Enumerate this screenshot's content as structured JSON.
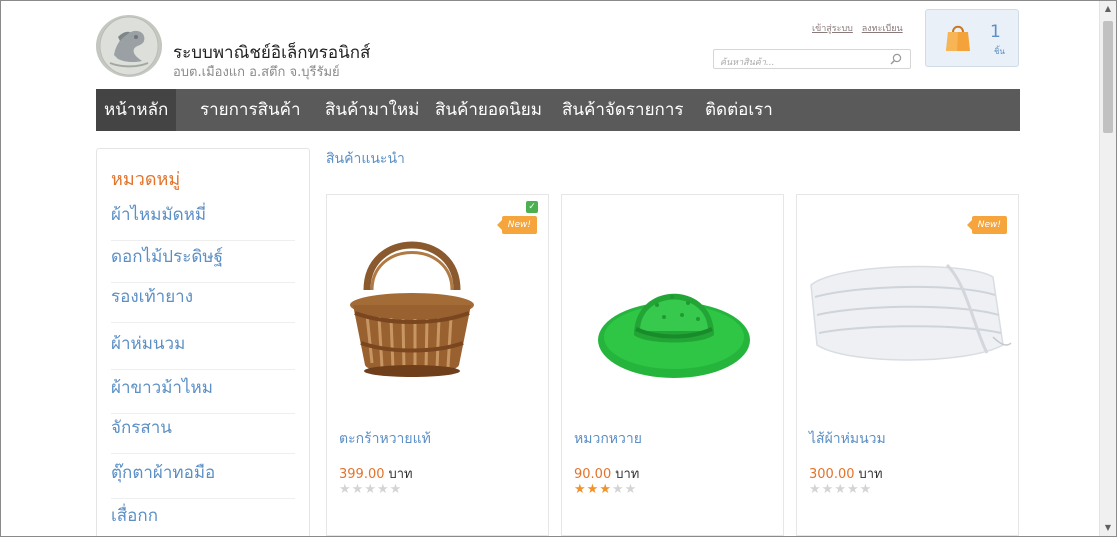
{
  "colors": {
    "accent_blue": "#5b8fc5",
    "accent_orange": "#e3732b",
    "nav_background": "#5a5a5a",
    "badge_orange": "#f5a53c",
    "star_active": "#f0932b",
    "star_inactive": "#d4d4d4"
  },
  "header": {
    "title": "ระบบพาณิชย์อิเล็กทรอนิกส์",
    "subtitle": "อบต.เมืองแก อ.สตึก จ.บุรีรัมย์",
    "logo_icon": "seal-logo-icon",
    "login_link": "เข้าสู่ระบบ",
    "register_link": "ลงทะเบียน",
    "search": {
      "placeholder": "ค้นหาสินค้า...",
      "value": "",
      "icon": "search-icon"
    },
    "cart": {
      "count": "1",
      "unit": "ชิ้น",
      "icon": "shopping-bag-icon"
    }
  },
  "nav": {
    "items": [
      {
        "label": "หน้าหลัก",
        "active": true
      },
      {
        "label": "รายการสินค้า",
        "active": false
      },
      {
        "label": "สินค้ามาใหม่",
        "active": false
      },
      {
        "label": "สินค้ายอดนิยม",
        "active": false
      },
      {
        "label": "สินค้าจัดรายการ",
        "active": false
      },
      {
        "label": "ติดต่อเรา",
        "active": false
      }
    ]
  },
  "sidebar": {
    "heading": "หมวดหมู่",
    "items": [
      {
        "label": "ผ้าไหมมัดหมี่"
      },
      {
        "label": "ดอกไม้ประดิษฐ์"
      },
      {
        "label": "รองเท้ายาง"
      },
      {
        "label": "ผ้าห่มนวม"
      },
      {
        "label": "ผ้าขาวม้าไหม"
      },
      {
        "label": "จักรสาน"
      },
      {
        "label": "ตุ๊กตาผ้าทอมือ"
      },
      {
        "label": "เสื่อกก"
      }
    ]
  },
  "main": {
    "section_title": "สินค้าแนะนำ",
    "products": [
      {
        "name": "ตะกร้าหวายแท้",
        "price": "399.00",
        "currency": "บาท",
        "rating": 0,
        "max_rating": 5,
        "badge": "New!",
        "checked": true,
        "image_icon": "rattan-basket-image"
      },
      {
        "name": "หมวกหวาย",
        "price": "90.00",
        "currency": "บาท",
        "rating": 3,
        "max_rating": 5,
        "badge": "",
        "checked": false,
        "image_icon": "green-straw-hat-image"
      },
      {
        "name": "ไส้ผ้าห่มนวม",
        "price": "300.00",
        "currency": "บาท",
        "rating": 0,
        "max_rating": 5,
        "badge": "New!",
        "checked": false,
        "image_icon": "white-comforter-image"
      }
    ]
  }
}
